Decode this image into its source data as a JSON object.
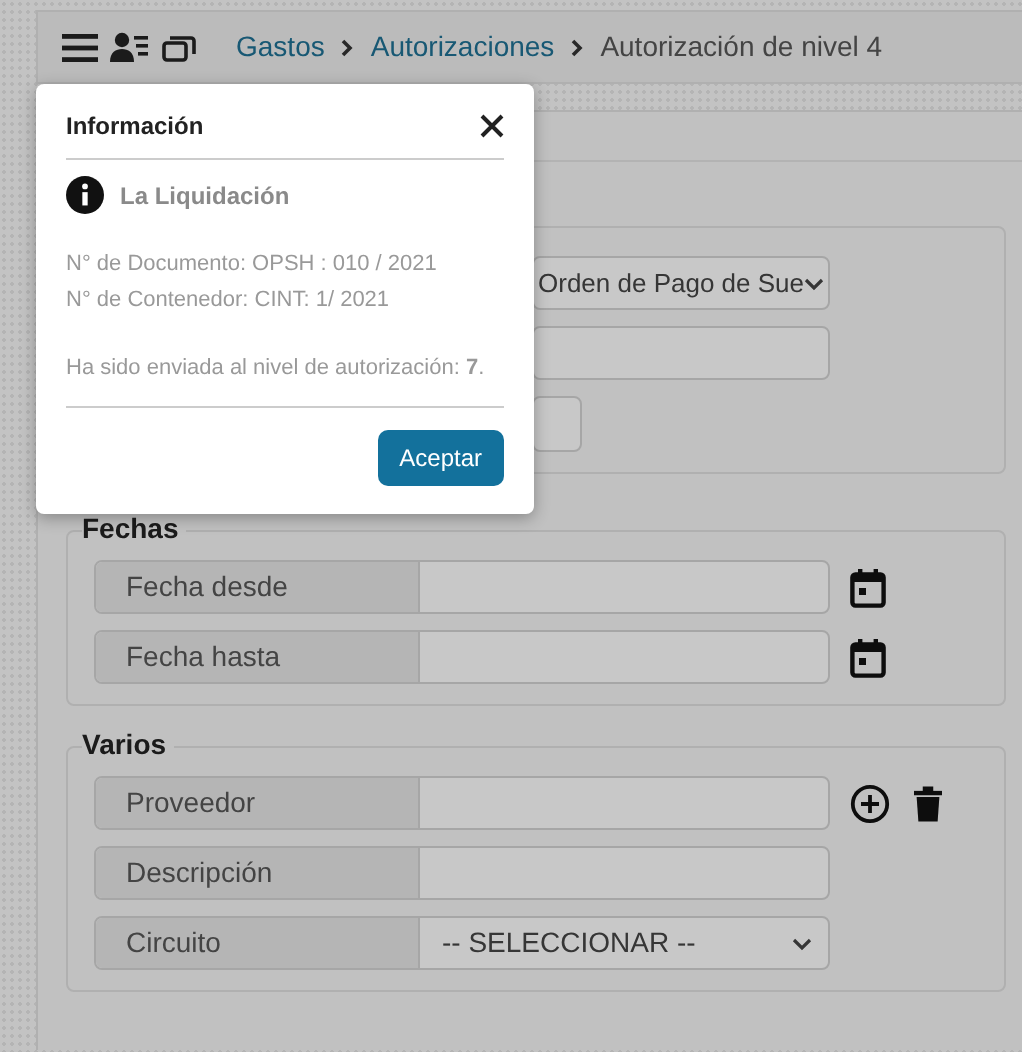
{
  "header": {
    "breadcrumb": [
      {
        "label": "Gastos",
        "link": true
      },
      {
        "label": "Autorizaciones",
        "link": true
      },
      {
        "label": "Autorización de nivel 4",
        "link": false
      }
    ]
  },
  "filters": {
    "fields": [
      {
        "kind": "select",
        "value": "Orden de Pago de Sue"
      },
      {
        "kind": "input"
      },
      {
        "kind": "short"
      }
    ]
  },
  "fechas": {
    "legend": "Fechas",
    "fields": [
      {
        "label": "Fecha desde",
        "kind": "date"
      },
      {
        "label": "Fecha hasta",
        "kind": "date"
      }
    ]
  },
  "varios": {
    "legend": "Varios",
    "fields": [
      {
        "label": "Proveedor",
        "kind": "lookup"
      },
      {
        "label": "Descripción",
        "kind": "text"
      },
      {
        "label": "Circuito",
        "kind": "select",
        "value": "-- SELECCIONAR --"
      }
    ]
  },
  "modal": {
    "title": "Información",
    "heading": "La Liquidación",
    "lines": [
      "N° de Documento: OPSH : 010 / 2021",
      "N° de Contenedor: CINT: 1/ 2021"
    ],
    "message": "Ha sido enviada al nivel de autorización: **7**.",
    "button": "Aceptar"
  }
}
